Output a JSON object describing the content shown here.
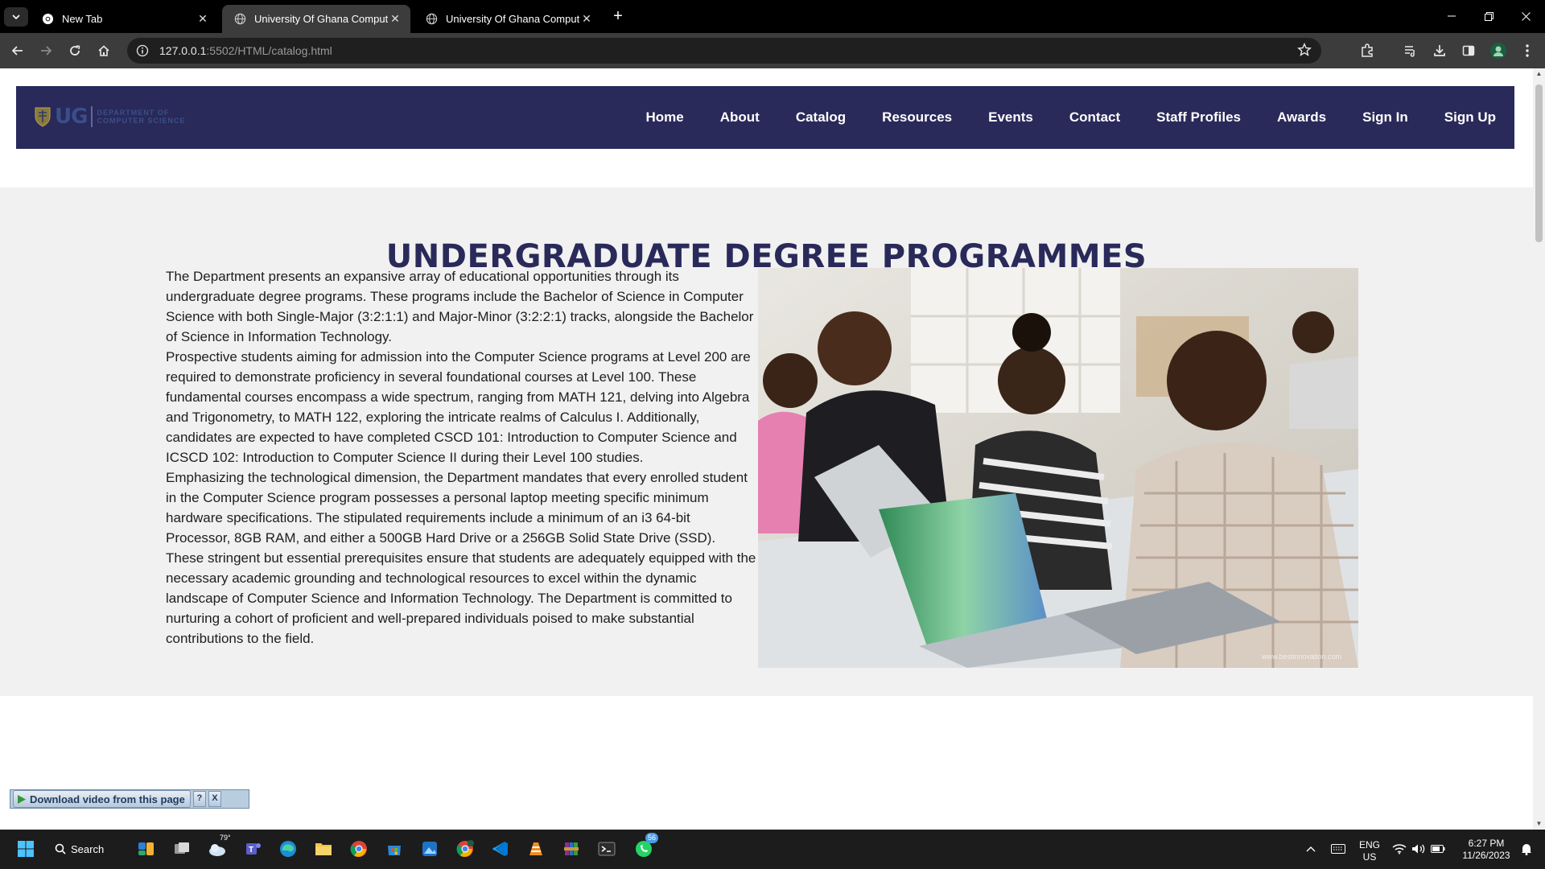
{
  "browser": {
    "tabs": [
      {
        "title": "New Tab",
        "active": false
      },
      {
        "title": "University Of Ghana Computer",
        "active": true
      },
      {
        "title": "University Of Ghana Computer",
        "active": false
      }
    ],
    "address": {
      "host": "127.0.0.1",
      "rest": ":5502/HTML/catalog.html"
    }
  },
  "site": {
    "logo": {
      "initials": "UG",
      "dept_line1": "DEPARTMENT OF",
      "dept_line2": "COMPUTER SCIENCE"
    },
    "nav": [
      "Home",
      "About",
      "Catalog",
      "Resources",
      "Events",
      "Contact",
      "Staff Profiles",
      "Awards",
      "Sign In",
      "Sign Up"
    ]
  },
  "main": {
    "heading": "UNDERGRADUATE DEGREE PROGRAMMES",
    "paragraphs": [
      "The Department presents an expansive array of educational opportunities through its undergraduate degree programs. These programs include the Bachelor of Science in Computer Science with both Single-Major (3:2:1:1) and Major-Minor (3:2:2:1) tracks, alongside the Bachelor of Science in Information Technology.",
      "Prospective students aiming for admission into the Computer Science programs at Level 200 are required to demonstrate proficiency in several foundational courses at Level 100. These fundamental courses encompass a wide spectrum, ranging from MATH 121, delving into Algebra and Trigonometry, to MATH 122, exploring the intricate realms of Calculus I. Additionally, candidates are expected to have completed CSCD 101: Introduction to Computer Science and ICSCD 102: Introduction to Computer Science II during their Level 100 studies.",
      "Emphasizing the technological dimension, the Department mandates that every enrolled student in the Computer Science program possesses a personal laptop meeting specific minimum hardware specifications. The stipulated requirements include a minimum of an i3 64-bit Processor, 8GB RAM, and either a 500GB Hard Drive or a 256GB Solid State Drive (SSD).",
      "These stringent but essential prerequisites ensure that students are adequately equipped with the necessary academic grounding and technological resources to excel within the dynamic landscape of Computer Science and Information Technology. The Department is committed to nurturing a cohort of proficient and well-prepared individuals poised to make substantial contributions to the field."
    ],
    "photo_watermark": "www.bestinnovation.com"
  },
  "download_bar": {
    "label": "Download video from this page",
    "help": "?",
    "close": "X"
  },
  "taskbar": {
    "search_label": "Search",
    "weather_temp": "79°",
    "whatsapp_badge": "56",
    "lang_line1": "ENG",
    "lang_line2": "US",
    "time": "6:27 PM",
    "date": "11/26/2023"
  },
  "colors": {
    "nav_bg": "#29295a",
    "heading": "#29295a",
    "band_bg": "#f1f1f1"
  }
}
